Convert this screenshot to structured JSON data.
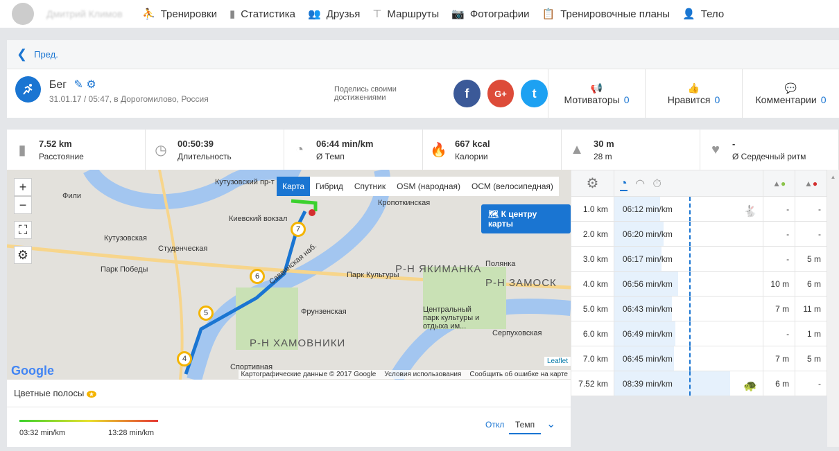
{
  "topnav": {
    "user": "Дмитрий Климов",
    "items": [
      {
        "label": "Тренировки",
        "icon": "running-icon"
      },
      {
        "label": "Статистика",
        "icon": "bar-chart-icon"
      },
      {
        "label": "Друзья",
        "icon": "friends-icon"
      },
      {
        "label": "Маршруты",
        "icon": "signpost-icon"
      },
      {
        "label": "Фотографии",
        "icon": "camera-icon"
      },
      {
        "label": "Тренировочные планы",
        "icon": "clipboard-icon"
      },
      {
        "label": "Тело",
        "icon": "person-icon"
      }
    ]
  },
  "back": "Пред.",
  "workout": {
    "title": "Бег",
    "subtitle": "31.01.17 / 05:47, в Дорогомилово, Россия",
    "share": "Поделись своими достижениями",
    "social": [
      "f",
      "G+",
      "t"
    ]
  },
  "counters": [
    {
      "label": "Мотиваторы",
      "value": "0"
    },
    {
      "label": "Нравится",
      "value": "0"
    },
    {
      "label": "Комментарии",
      "value": "0"
    }
  ],
  "stats": [
    {
      "value": "7.52 km",
      "label": "Расстояние"
    },
    {
      "value": "00:50:39",
      "label": "Длительность"
    },
    {
      "value": "06:44 min/km",
      "label": "Ø Темп"
    },
    {
      "value": "667 kcal",
      "label": "Калории"
    },
    {
      "value": "30 m",
      "label": "28 m"
    },
    {
      "value": "-",
      "label": "Ø Сердечный ритм"
    }
  ],
  "map": {
    "tabs": [
      "Карта",
      "Гибрид",
      "Спутник",
      "OSM (народная)",
      "ОСМ (велосипедная)"
    ],
    "center_btn": "К центру карты",
    "labels": [
      "Кутузовский пр-т",
      "Фили",
      "Киевский вокзал",
      "Кутузовская",
      "Студенческая",
      "Парк Победы",
      "Кропоткинская",
      "Парк Культуры",
      "Р-Н ЯКИМАНКА",
      "Р-Н ЗАМОСК",
      "Полянка",
      "Центральный парк культуры и отдыха им...",
      "Фрунзенская",
      "Р-Н ХАМОВНИКИ",
      "Спортивная",
      "Серпуховская",
      "Саввинская наб."
    ],
    "pins": [
      "7",
      "6",
      "5",
      "4"
    ],
    "attribution": "Картографические данные © 2017 Google",
    "terms": "Условия использования",
    "report": "Сообщить об ошибке на карте",
    "leaflet": "Leaflet",
    "google": "Google",
    "zoom_in": "+",
    "zoom_out": "−"
  },
  "splits": [
    {
      "dist": "1.0 km",
      "pace": "06:12 min/km",
      "fill": 0.31,
      "up": "-",
      "down": "-",
      "icon": "rabbit"
    },
    {
      "dist": "2.0 km",
      "pace": "06:20 min/km",
      "fill": 0.33,
      "up": "-",
      "down": "-"
    },
    {
      "dist": "3.0 km",
      "pace": "06:17 min/km",
      "fill": 0.32,
      "up": "-",
      "down": "5 m"
    },
    {
      "dist": "4.0 km",
      "pace": "06:56 min/km",
      "fill": 0.43,
      "up": "10 m",
      "down": "6 m"
    },
    {
      "dist": "5.0 km",
      "pace": "06:43 min/km",
      "fill": 0.39,
      "up": "7 m",
      "down": "11 m"
    },
    {
      "dist": "6.0 km",
      "pace": "06:49 min/km",
      "fill": 0.41,
      "up": "-",
      "down": "1 m"
    },
    {
      "dist": "7.0 km",
      "pace": "06:45 min/km",
      "fill": 0.4,
      "up": "7 m",
      "down": "5 m"
    },
    {
      "dist": "7.52 km",
      "pace": "08:39 min/km",
      "fill": 0.78,
      "up": "6 m",
      "down": "-",
      "icon": "turtle"
    }
  ],
  "legend": {
    "title": "Цветные полосы",
    "min": "03:32 min/km",
    "max": "13:28 min/km",
    "off": "Откл",
    "tempo": "Темп"
  },
  "colors": {
    "accent": "#1a75d2"
  }
}
